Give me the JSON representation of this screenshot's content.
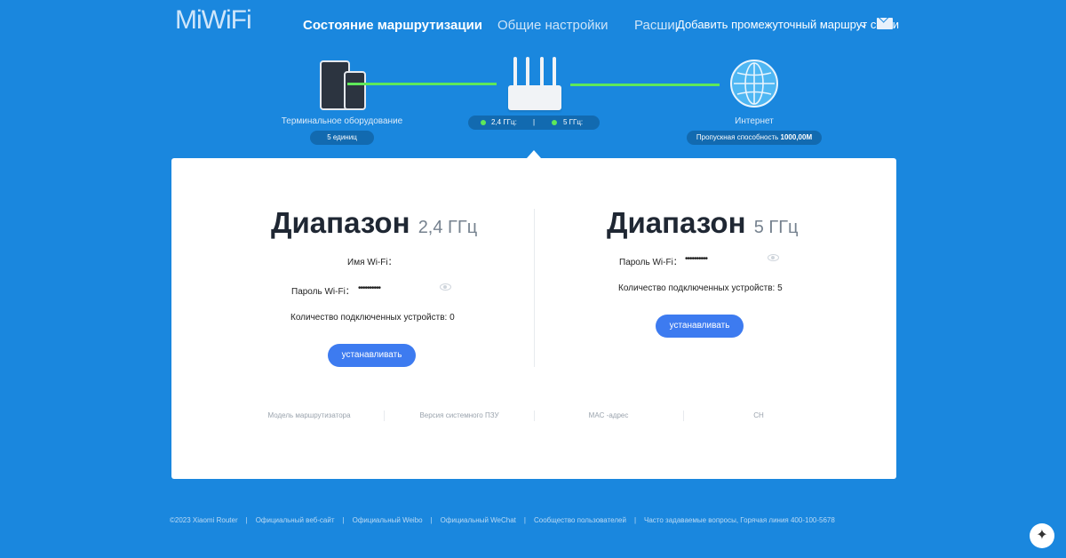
{
  "header": {
    "logo": "MiWiFi",
    "nav": [
      "Состояние маршрутизации",
      "Общие настройки",
      "Расширенные настройки"
    ],
    "nav_overlay": "Добавить промежуточный маршрут сетки",
    "chevron": "⌄",
    "mail_icon": "mail-icon"
  },
  "topology": {
    "devices_label": "Терминальное оборудование",
    "devices_count": "5 единиц",
    "band_24": "2,4 ГГц:",
    "band_5": "5 ГГц:",
    "band_divider": "|",
    "internet_label": "Интернет",
    "bandwidth_prefix": "Пропускная способность",
    "bandwidth_value": "1000,00M",
    "link_color": "#5ee85a"
  },
  "band24": {
    "title": "Диапазон",
    "freq": "2,4 ГГц",
    "wifi_name_label": "Имя Wi-Fi：",
    "wifi_password_label": "Пароль Wi-Fi：",
    "password_mask": "••••••••••",
    "connected_label": "Количество подключенных устройств: 0",
    "button": "устанавливать"
  },
  "band5": {
    "title": "Диапазон",
    "freq": "5 ГГц",
    "wifi_password_label": "Пароль Wi-Fi：",
    "password_mask": "••••••••••",
    "connected_label": "Количество подключенных устройств: 5",
    "button": "устанавливать"
  },
  "info": [
    "Модель маршрутизатора",
    "Версия системного ПЗУ",
    "MAC -адрес",
    "CH"
  ],
  "footer": {
    "copyright": "©2023 Xiaomi Router",
    "links": [
      "Официальный веб-сайт",
      "Официальный Weibo",
      "Официальный WeChat",
      "Сообщество пользователей",
      "Часто задаваемые вопросы, Горячая линия 400-100-5678"
    ],
    "separator": "|"
  },
  "colors": {
    "background": "#1a87de",
    "card": "#ffffff",
    "button": "#3d7bf0",
    "active_link": "#5ee85a"
  }
}
